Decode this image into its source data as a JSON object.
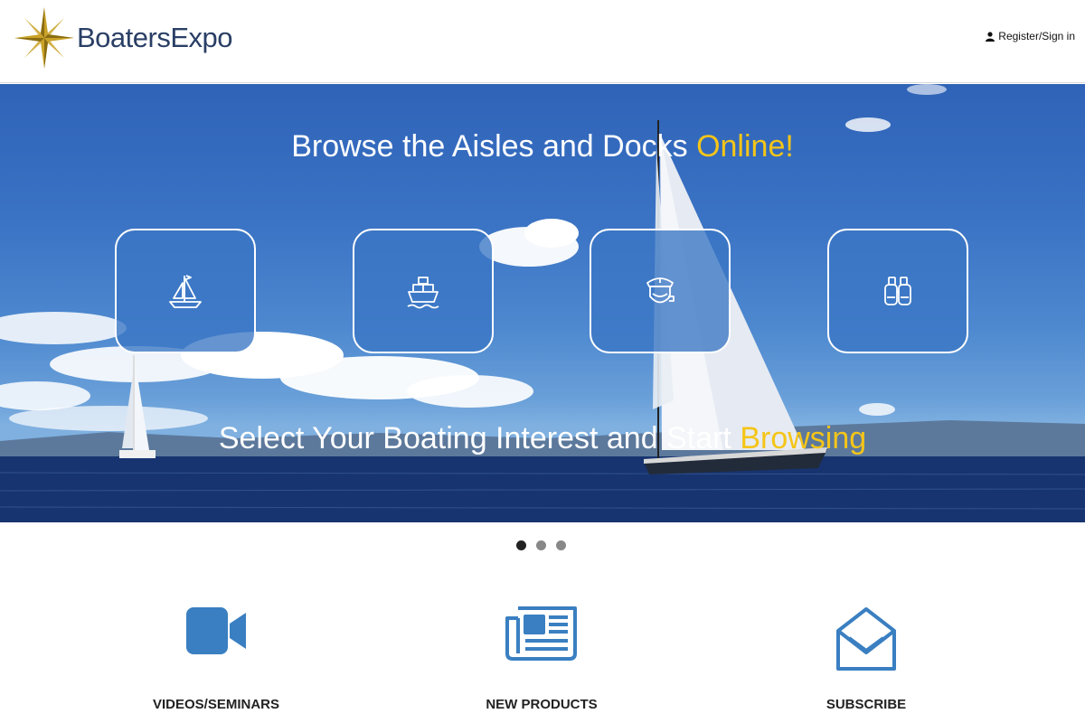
{
  "header": {
    "logo_text": "BoatersExpo",
    "logo_icon": "compass-star-icon",
    "register_label": "Register/Sign in",
    "register_icon": "user-icon"
  },
  "hero": {
    "title_main": "Browse the Aisles and Docks ",
    "title_accent": "Online!",
    "subtitle_main": "Select Your Boating Interest and Start ",
    "subtitle_accent": "Browsing",
    "accent_color": "#f5c518",
    "tiles": [
      {
        "icon": "sailboat-icon"
      },
      {
        "icon": "ship-icon"
      },
      {
        "icon": "captain-icon"
      },
      {
        "icon": "binoculars-icon"
      }
    ]
  },
  "carousel": {
    "slides": 3,
    "active_index": 0
  },
  "features": [
    {
      "label": "VIDEOS/SEMINARS",
      "icon": "video-camera-icon"
    },
    {
      "label": "NEW PRODUCTS",
      "icon": "newspaper-icon"
    },
    {
      "label": "SUBSCRIBE",
      "icon": "envelope-icon"
    }
  ],
  "colors": {
    "brand_navy": "#2a3f66",
    "icon_blue": "#3a7fc1",
    "tile_bg": "#3a76c4"
  }
}
